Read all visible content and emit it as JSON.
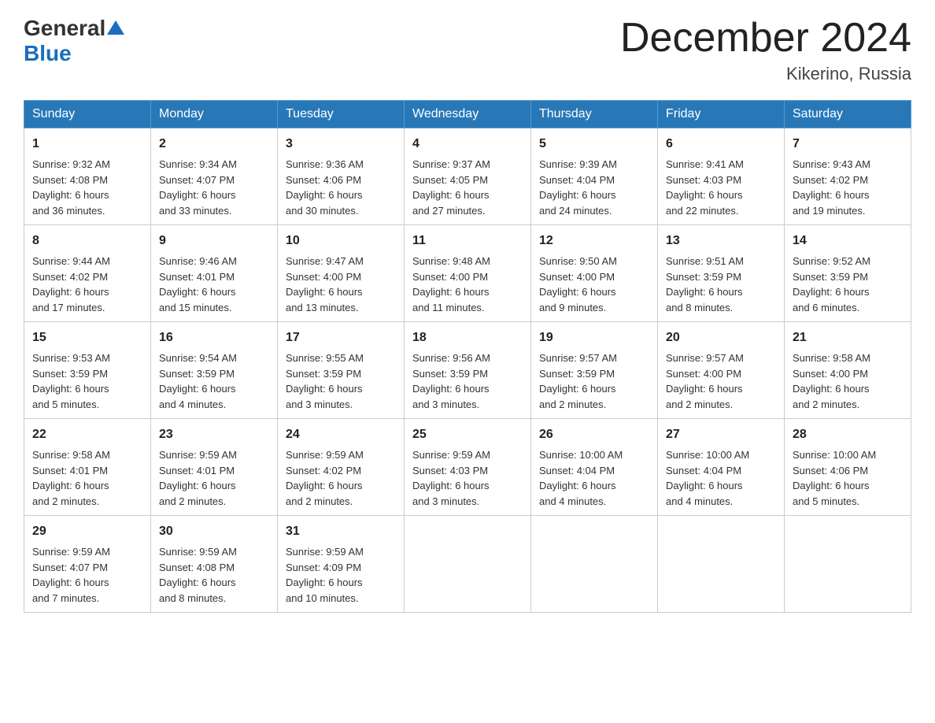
{
  "header": {
    "logo_general": "General",
    "logo_blue": "Blue",
    "title": "December 2024",
    "location": "Kikerino, Russia"
  },
  "days_of_week": [
    "Sunday",
    "Monday",
    "Tuesday",
    "Wednesday",
    "Thursday",
    "Friday",
    "Saturday"
  ],
  "weeks": [
    [
      {
        "day": "1",
        "info": "Sunrise: 9:32 AM\nSunset: 4:08 PM\nDaylight: 6 hours\nand 36 minutes."
      },
      {
        "day": "2",
        "info": "Sunrise: 9:34 AM\nSunset: 4:07 PM\nDaylight: 6 hours\nand 33 minutes."
      },
      {
        "day": "3",
        "info": "Sunrise: 9:36 AM\nSunset: 4:06 PM\nDaylight: 6 hours\nand 30 minutes."
      },
      {
        "day": "4",
        "info": "Sunrise: 9:37 AM\nSunset: 4:05 PM\nDaylight: 6 hours\nand 27 minutes."
      },
      {
        "day": "5",
        "info": "Sunrise: 9:39 AM\nSunset: 4:04 PM\nDaylight: 6 hours\nand 24 minutes."
      },
      {
        "day": "6",
        "info": "Sunrise: 9:41 AM\nSunset: 4:03 PM\nDaylight: 6 hours\nand 22 minutes."
      },
      {
        "day": "7",
        "info": "Sunrise: 9:43 AM\nSunset: 4:02 PM\nDaylight: 6 hours\nand 19 minutes."
      }
    ],
    [
      {
        "day": "8",
        "info": "Sunrise: 9:44 AM\nSunset: 4:02 PM\nDaylight: 6 hours\nand 17 minutes."
      },
      {
        "day": "9",
        "info": "Sunrise: 9:46 AM\nSunset: 4:01 PM\nDaylight: 6 hours\nand 15 minutes."
      },
      {
        "day": "10",
        "info": "Sunrise: 9:47 AM\nSunset: 4:00 PM\nDaylight: 6 hours\nand 13 minutes."
      },
      {
        "day": "11",
        "info": "Sunrise: 9:48 AM\nSunset: 4:00 PM\nDaylight: 6 hours\nand 11 minutes."
      },
      {
        "day": "12",
        "info": "Sunrise: 9:50 AM\nSunset: 4:00 PM\nDaylight: 6 hours\nand 9 minutes."
      },
      {
        "day": "13",
        "info": "Sunrise: 9:51 AM\nSunset: 3:59 PM\nDaylight: 6 hours\nand 8 minutes."
      },
      {
        "day": "14",
        "info": "Sunrise: 9:52 AM\nSunset: 3:59 PM\nDaylight: 6 hours\nand 6 minutes."
      }
    ],
    [
      {
        "day": "15",
        "info": "Sunrise: 9:53 AM\nSunset: 3:59 PM\nDaylight: 6 hours\nand 5 minutes."
      },
      {
        "day": "16",
        "info": "Sunrise: 9:54 AM\nSunset: 3:59 PM\nDaylight: 6 hours\nand 4 minutes."
      },
      {
        "day": "17",
        "info": "Sunrise: 9:55 AM\nSunset: 3:59 PM\nDaylight: 6 hours\nand 3 minutes."
      },
      {
        "day": "18",
        "info": "Sunrise: 9:56 AM\nSunset: 3:59 PM\nDaylight: 6 hours\nand 3 minutes."
      },
      {
        "day": "19",
        "info": "Sunrise: 9:57 AM\nSunset: 3:59 PM\nDaylight: 6 hours\nand 2 minutes."
      },
      {
        "day": "20",
        "info": "Sunrise: 9:57 AM\nSunset: 4:00 PM\nDaylight: 6 hours\nand 2 minutes."
      },
      {
        "day": "21",
        "info": "Sunrise: 9:58 AM\nSunset: 4:00 PM\nDaylight: 6 hours\nand 2 minutes."
      }
    ],
    [
      {
        "day": "22",
        "info": "Sunrise: 9:58 AM\nSunset: 4:01 PM\nDaylight: 6 hours\nand 2 minutes."
      },
      {
        "day": "23",
        "info": "Sunrise: 9:59 AM\nSunset: 4:01 PM\nDaylight: 6 hours\nand 2 minutes."
      },
      {
        "day": "24",
        "info": "Sunrise: 9:59 AM\nSunset: 4:02 PM\nDaylight: 6 hours\nand 2 minutes."
      },
      {
        "day": "25",
        "info": "Sunrise: 9:59 AM\nSunset: 4:03 PM\nDaylight: 6 hours\nand 3 minutes."
      },
      {
        "day": "26",
        "info": "Sunrise: 10:00 AM\nSunset: 4:04 PM\nDaylight: 6 hours\nand 4 minutes."
      },
      {
        "day": "27",
        "info": "Sunrise: 10:00 AM\nSunset: 4:04 PM\nDaylight: 6 hours\nand 4 minutes."
      },
      {
        "day": "28",
        "info": "Sunrise: 10:00 AM\nSunset: 4:06 PM\nDaylight: 6 hours\nand 5 minutes."
      }
    ],
    [
      {
        "day": "29",
        "info": "Sunrise: 9:59 AM\nSunset: 4:07 PM\nDaylight: 6 hours\nand 7 minutes."
      },
      {
        "day": "30",
        "info": "Sunrise: 9:59 AM\nSunset: 4:08 PM\nDaylight: 6 hours\nand 8 minutes."
      },
      {
        "day": "31",
        "info": "Sunrise: 9:59 AM\nSunset: 4:09 PM\nDaylight: 6 hours\nand 10 minutes."
      },
      null,
      null,
      null,
      null
    ]
  ]
}
